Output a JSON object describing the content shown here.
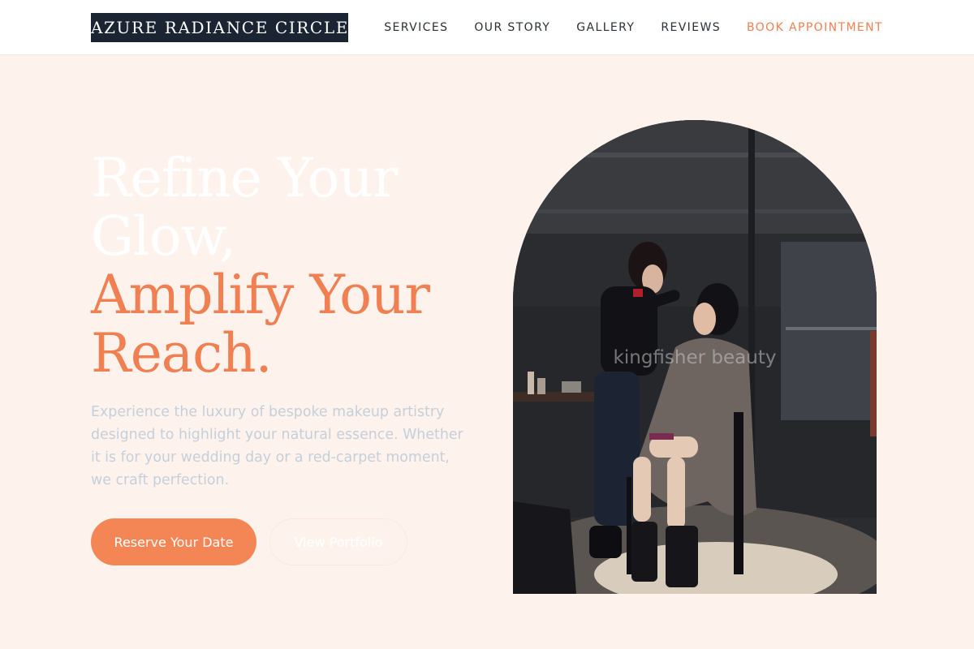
{
  "brand": {
    "name": "AZURE RADIANCE CIRCLE"
  },
  "nav": {
    "items": [
      {
        "label": "SERVICES"
      },
      {
        "label": "OUR STORY"
      },
      {
        "label": "GALLERY"
      },
      {
        "label": "REVIEWS"
      },
      {
        "label": "BOOK APPOINTMENT"
      }
    ]
  },
  "hero": {
    "title_lines": [
      "Refine Your",
      "Glow,",
      "Amplify Your",
      "Reach."
    ],
    "description": "Experience the luxury of bespoke makeup artistry designed to highlight your natural essence. Whether it is for your wedding day or a red-carpet moment, we craft perfection.",
    "primary_button": "Reserve Your Date",
    "secondary_button": "View Portfolio"
  },
  "image": {
    "watermark": "kingfisher beauty"
  },
  "colors": {
    "accent": "#f07f52",
    "button": "#f48656",
    "logo_bg": "#1b2433",
    "page_bg": "#fdf3ec"
  }
}
